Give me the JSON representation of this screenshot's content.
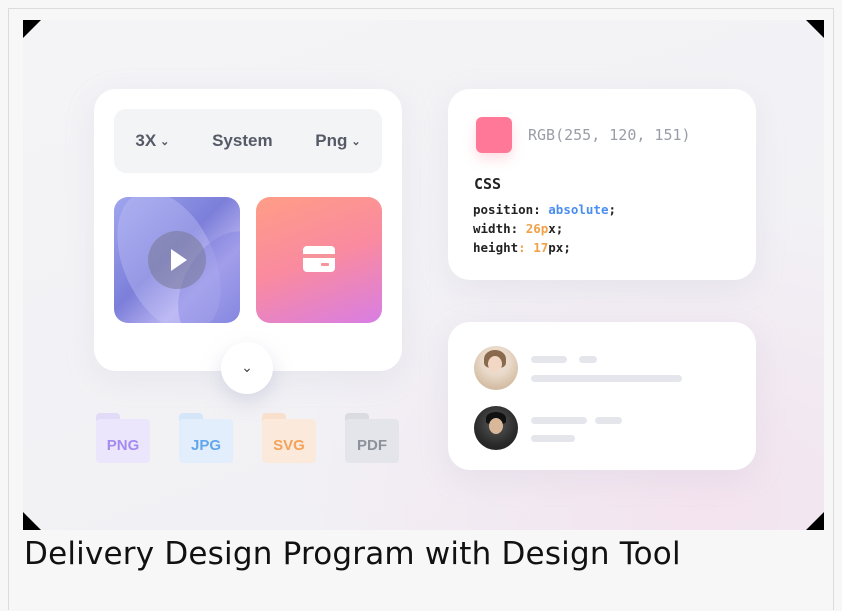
{
  "toolbar": {
    "scale": "3X",
    "mode": "System",
    "format": "Png"
  },
  "color": {
    "swatch_hex": "#ff7897",
    "rgb_text": "RGB(255, 120, 151)"
  },
  "css": {
    "title": "CSS",
    "line1_prop": "position:",
    "line1_val": "absolute",
    "line1_end": ";",
    "line2_prop": "width:",
    "line2_num": "26",
    "line2_unit_p": "p",
    "line2_unit_x": "x;",
    "line3_prop": "height",
    "line3_colon": ":",
    "line3_num": "17",
    "line3_unit": "px;"
  },
  "folders": [
    {
      "label": "PNG",
      "text_color": "#a58bf0",
      "bg": "#ebe6fb",
      "tab": "#e1dbf8"
    },
    {
      "label": "JPG",
      "text_color": "#62a6ec",
      "bg": "#e2eefb",
      "tab": "#d6e6f9"
    },
    {
      "label": "SVG",
      "text_color": "#f4a25a",
      "bg": "#fbeadb",
      "tab": "#f8e0cc"
    },
    {
      "label": "PDF",
      "text_color": "#8d919b",
      "bg": "#e4e5ea",
      "tab": "#dadbe1"
    }
  ],
  "icons": {
    "play": "play-icon",
    "card": "credit-card-icon",
    "expand": "chevron-down-icon"
  },
  "caption": "Delivery Design Program with Design Tool"
}
